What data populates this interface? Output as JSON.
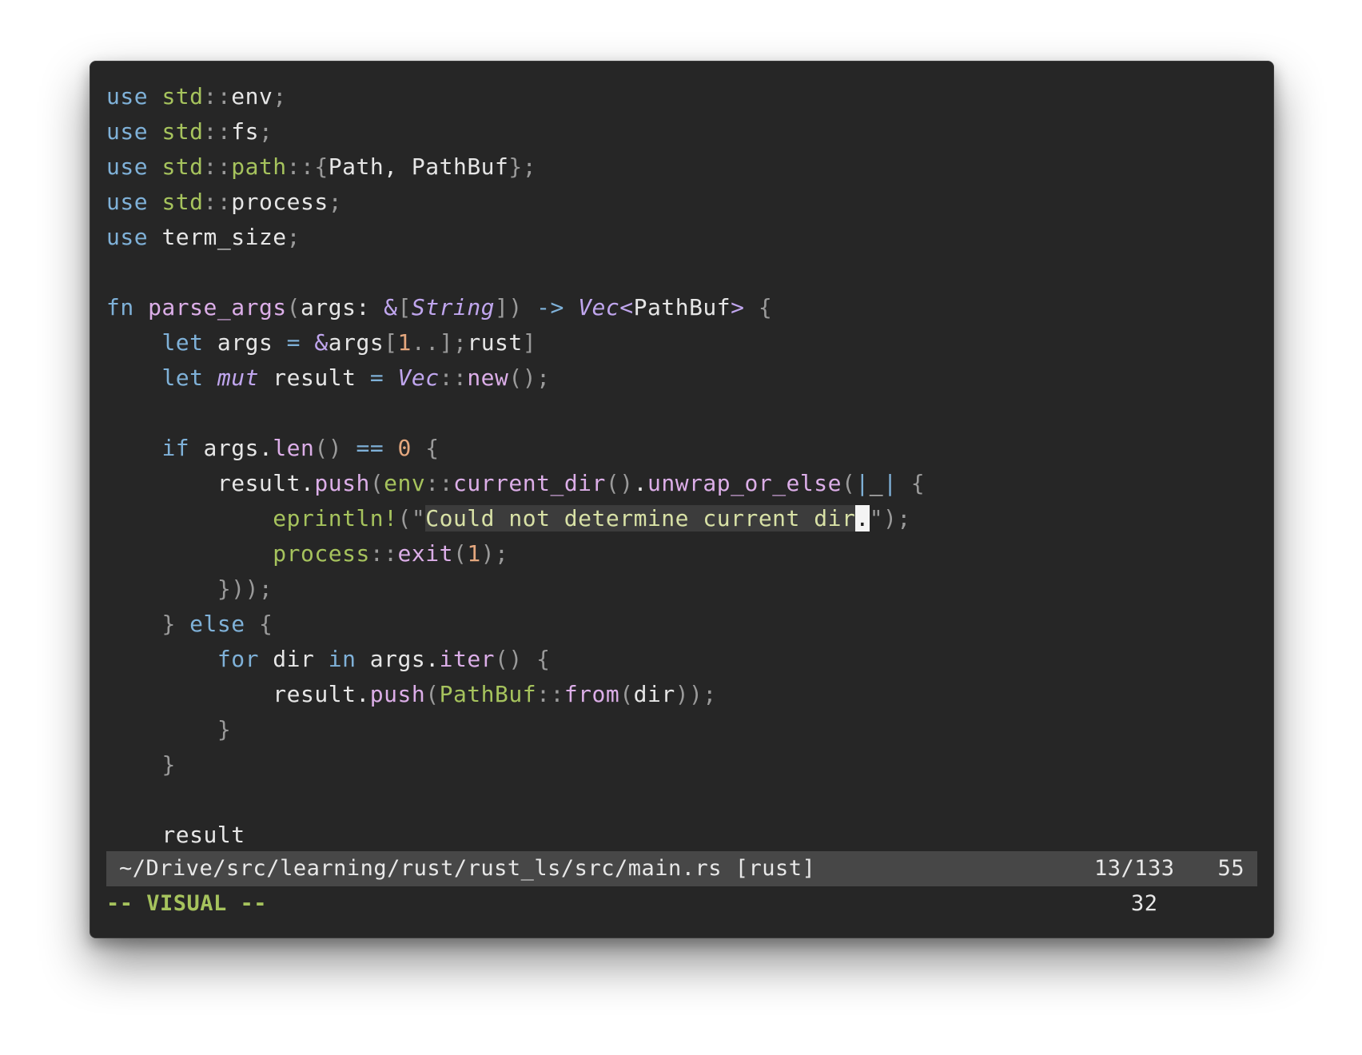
{
  "editor": {
    "language": "rust",
    "colors": {
      "background": "#262626",
      "keyword": "#7fb1d8",
      "module": "#a6c35d",
      "function": "#dcaee8",
      "type": "#c0a6ee",
      "number": "#e4a77e",
      "string": "#d8e1a6",
      "punctuation": "#9a9a9a",
      "identifier": "#e6e6e6",
      "selection": "#3c3c3c",
      "cursor": "#f4f4f4"
    },
    "lines": [
      [
        {
          "t": "use",
          "c": "kw"
        },
        {
          "t": " "
        },
        {
          "t": "std",
          "c": "mod"
        },
        {
          "t": "::",
          "c": "p"
        },
        {
          "t": "env"
        },
        {
          "t": ";",
          "c": "p"
        }
      ],
      [
        {
          "t": "use",
          "c": "kw"
        },
        {
          "t": " "
        },
        {
          "t": "std",
          "c": "mod"
        },
        {
          "t": "::",
          "c": "p"
        },
        {
          "t": "fs"
        },
        {
          "t": ";",
          "c": "p"
        }
      ],
      [
        {
          "t": "use",
          "c": "kw"
        },
        {
          "t": " "
        },
        {
          "t": "std",
          "c": "mod"
        },
        {
          "t": "::",
          "c": "p"
        },
        {
          "t": "path",
          "c": "mod"
        },
        {
          "t": "::{",
          "c": "p"
        },
        {
          "t": "Path, PathBuf"
        },
        {
          "t": "};",
          "c": "p"
        }
      ],
      [
        {
          "t": "use",
          "c": "kw"
        },
        {
          "t": " "
        },
        {
          "t": "std",
          "c": "mod"
        },
        {
          "t": "::",
          "c": "p"
        },
        {
          "t": "process"
        },
        {
          "t": ";",
          "c": "p"
        }
      ],
      [
        {
          "t": "use",
          "c": "kw"
        },
        {
          "t": " "
        },
        {
          "t": "term_size"
        },
        {
          "t": ";",
          "c": "p"
        }
      ],
      [],
      [
        {
          "t": "fn",
          "c": "kw"
        },
        {
          "t": " "
        },
        {
          "t": "parse_args",
          "c": "fn"
        },
        {
          "t": "(",
          "c": "p"
        },
        {
          "t": "args: "
        },
        {
          "t": "&",
          "c": "ty"
        },
        {
          "t": "[",
          "c": "p"
        },
        {
          "t": "String",
          "c": "tyi"
        },
        {
          "t": "])",
          "c": "p"
        },
        {
          "t": " "
        },
        {
          "t": "->",
          "c": "kw"
        },
        {
          "t": " "
        },
        {
          "t": "Vec",
          "c": "tyi"
        },
        {
          "t": "<",
          "c": "ty"
        },
        {
          "t": "PathBuf"
        },
        {
          "t": ">",
          "c": "ty"
        },
        {
          "t": " "
        },
        {
          "t": "{",
          "c": "p"
        }
      ],
      [
        {
          "t": "    "
        },
        {
          "t": "let",
          "c": "kw"
        },
        {
          "t": " args "
        },
        {
          "t": "=",
          "c": "kw"
        },
        {
          "t": " "
        },
        {
          "t": "&",
          "c": "ty"
        },
        {
          "t": "args"
        },
        {
          "t": "[",
          "c": "p"
        },
        {
          "t": "1",
          "c": "num"
        },
        {
          "t": "..];",
          "c": "p"
        },
        {
          "t": "rust"
        },
        {
          "t": "]",
          "c": "p"
        }
      ],
      [
        {
          "t": "    "
        },
        {
          "t": "let",
          "c": "kw"
        },
        {
          "t": " "
        },
        {
          "t": "mut",
          "c": "tyi"
        },
        {
          "t": " result "
        },
        {
          "t": "=",
          "c": "kw"
        },
        {
          "t": " "
        },
        {
          "t": "Vec",
          "c": "tyi"
        },
        {
          "t": "::",
          "c": "p"
        },
        {
          "t": "new",
          "c": "fn"
        },
        {
          "t": "();",
          "c": "p"
        }
      ],
      [],
      [
        {
          "t": "    "
        },
        {
          "t": "if",
          "c": "kw"
        },
        {
          "t": " args."
        },
        {
          "t": "len",
          "c": "fn"
        },
        {
          "t": "()",
          "c": "p"
        },
        {
          "t": " "
        },
        {
          "t": "==",
          "c": "kw"
        },
        {
          "t": " "
        },
        {
          "t": "0",
          "c": "num"
        },
        {
          "t": " "
        },
        {
          "t": "{",
          "c": "p"
        }
      ],
      [
        {
          "t": "        result."
        },
        {
          "t": "push",
          "c": "fn"
        },
        {
          "t": "(",
          "c": "p"
        },
        {
          "t": "env",
          "c": "mod"
        },
        {
          "t": "::",
          "c": "p"
        },
        {
          "t": "current_dir",
          "c": "fn"
        },
        {
          "t": "()",
          "c": "p"
        },
        {
          "t": "."
        },
        {
          "t": "unwrap_or_else",
          "c": "fn"
        },
        {
          "t": "(",
          "c": "p"
        },
        {
          "t": "|",
          "c": "kw"
        },
        {
          "t": "_"
        },
        {
          "t": "|",
          "c": "kw"
        },
        {
          "t": " "
        },
        {
          "t": "{",
          "c": "p"
        }
      ],
      [
        {
          "t": "            "
        },
        {
          "t": "eprintln!",
          "c": "mod"
        },
        {
          "t": "(\"",
          "c": "p"
        },
        {
          "t": "Could not determine current dir",
          "c": "str",
          "hl": true
        },
        {
          "t": ".",
          "c": "cur"
        },
        {
          "t": "\");",
          "c": "p"
        }
      ],
      [
        {
          "t": "            "
        },
        {
          "t": "process",
          "c": "mod"
        },
        {
          "t": "::",
          "c": "p"
        },
        {
          "t": "exit",
          "c": "fn"
        },
        {
          "t": "(",
          "c": "p"
        },
        {
          "t": "1",
          "c": "num"
        },
        {
          "t": ");",
          "c": "p"
        }
      ],
      [
        {
          "t": "        "
        },
        {
          "t": "}));",
          "c": "p"
        }
      ],
      [
        {
          "t": "    "
        },
        {
          "t": "}",
          "c": "p"
        },
        {
          "t": " "
        },
        {
          "t": "else",
          "c": "kw"
        },
        {
          "t": " "
        },
        {
          "t": "{",
          "c": "p"
        }
      ],
      [
        {
          "t": "        "
        },
        {
          "t": "for",
          "c": "kw"
        },
        {
          "t": " dir "
        },
        {
          "t": "in",
          "c": "kw"
        },
        {
          "t": " args."
        },
        {
          "t": "iter",
          "c": "fn"
        },
        {
          "t": "()",
          "c": "p"
        },
        {
          "t": " "
        },
        {
          "t": "{",
          "c": "p"
        }
      ],
      [
        {
          "t": "            result."
        },
        {
          "t": "push",
          "c": "fn"
        },
        {
          "t": "(",
          "c": "p"
        },
        {
          "t": "PathBuf",
          "c": "mod"
        },
        {
          "t": "::",
          "c": "p"
        },
        {
          "t": "from",
          "c": "fn"
        },
        {
          "t": "(",
          "c": "p"
        },
        {
          "t": "dir"
        },
        {
          "t": "));",
          "c": "p"
        }
      ],
      [
        {
          "t": "        "
        },
        {
          "t": "}",
          "c": "p"
        }
      ],
      [
        {
          "t": "    "
        },
        {
          "t": "}",
          "c": "p"
        }
      ],
      [],
      [
        {
          "t": "    result"
        }
      ]
    ]
  },
  "statusbar": {
    "path": "~/Drive/src/learning/rust/rust_ls/src/main.rs [rust]",
    "line_position": "13/133",
    "column": "55"
  },
  "cmdline": {
    "mode": "-- VISUAL --",
    "selection_count": "32"
  }
}
